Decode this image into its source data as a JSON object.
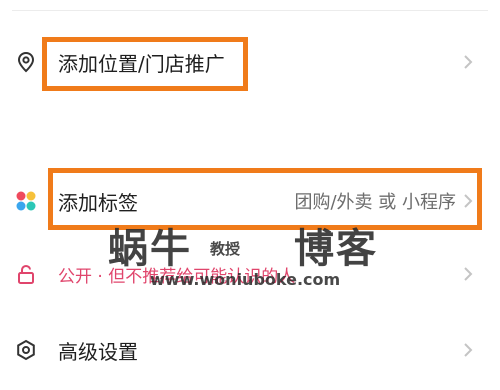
{
  "rows": {
    "location": {
      "label": "添加位置/门店推广",
      "icon": "location-pin-icon"
    },
    "tags": {
      "label": "添加标签",
      "value": "团购/外卖 或 小程序",
      "icon": "four-dots-icon"
    },
    "privacy": {
      "label": "公开 · 但不推荐给可能认识的人",
      "icon": "unlock-icon"
    },
    "advanced": {
      "label": "高级设置",
      "icon": "settings-circle-icon"
    }
  },
  "watermark": {
    "main": "蜗牛",
    "middle": "教授",
    "right": "博客",
    "url": "www.woniuboke.com"
  },
  "colors": {
    "highlight": "#f07b1a",
    "privacy_text": "#e0456c",
    "dot_red": "#ef4a5d",
    "dot_yellow": "#f6c13a",
    "dot_blue": "#3aa6ee",
    "dot_teal": "#2cc7b6"
  }
}
